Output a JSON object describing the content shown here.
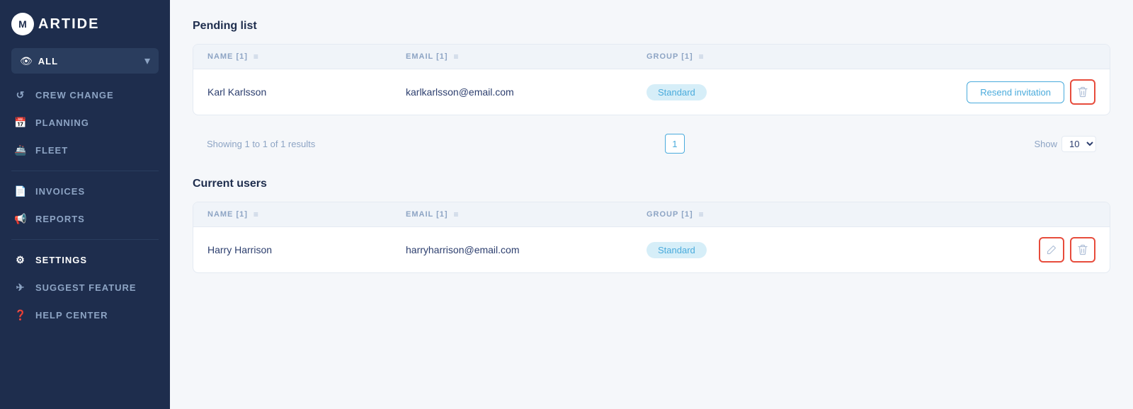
{
  "sidebar": {
    "logo_letter": "M",
    "logo_text": "ARTIDE",
    "filter": {
      "icon": "👁",
      "label": "ALL",
      "chevron": "▾"
    },
    "nav_items": [
      {
        "id": "crew-change",
        "icon": "↺",
        "label": "CREW CHANGE"
      },
      {
        "id": "planning",
        "icon": "📅",
        "label": "PLANNING"
      },
      {
        "id": "fleet",
        "icon": "🚢",
        "label": "FLEET"
      },
      {
        "id": "invoices",
        "icon": "📄",
        "label": "INVOICES"
      },
      {
        "id": "reports",
        "icon": "📢",
        "label": "REPORTS"
      },
      {
        "id": "settings",
        "icon": "⚙",
        "label": "SETTINGS",
        "active": true
      },
      {
        "id": "suggest-feature",
        "icon": "✈",
        "label": "SUGGEST FEATURE"
      },
      {
        "id": "help-center",
        "icon": "❓",
        "label": "HELP CENTER"
      }
    ]
  },
  "pending_list": {
    "section_title": "Pending list",
    "columns": [
      {
        "id": "name",
        "label": "NAME [1]"
      },
      {
        "id": "email",
        "label": "EMAIL [1]"
      },
      {
        "id": "group",
        "label": "GROUP [1]"
      },
      {
        "id": "actions",
        "label": ""
      }
    ],
    "rows": [
      {
        "name": "Karl Karlsson",
        "email": "karlkarlsson@email.com",
        "group": "Standard",
        "resend_label": "Resend invitation"
      }
    ],
    "pagination": {
      "showing": "Showing 1 to 1 of 1 results",
      "page": "1",
      "show_label": "Show",
      "show_value": "10"
    }
  },
  "current_users": {
    "section_title": "Current users",
    "columns": [
      {
        "id": "name",
        "label": "NAME [1]"
      },
      {
        "id": "email",
        "label": "EMAIL [1]"
      },
      {
        "id": "group",
        "label": "GROUP [1]"
      },
      {
        "id": "actions",
        "label": ""
      }
    ],
    "rows": [
      {
        "name": "Harry Harrison",
        "email": "harryharrison@email.com",
        "group": "Standard"
      }
    ]
  },
  "icons": {
    "filter": "≡",
    "trash": "🗑",
    "edit": "✏",
    "chevron_down": "▾",
    "eye": "👁"
  }
}
